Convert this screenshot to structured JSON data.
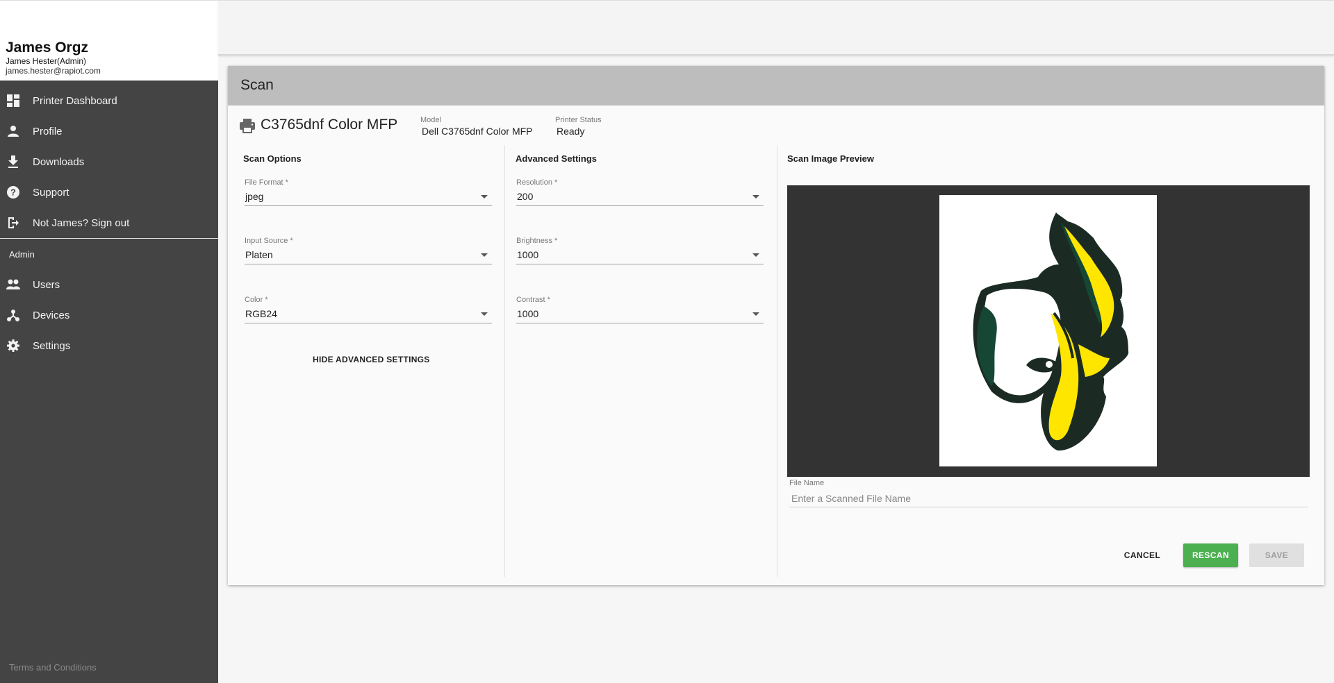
{
  "user": {
    "org": "James Orgz",
    "name": "James Hester",
    "role": "(Admin)",
    "email": "james.hester@rapiot.com"
  },
  "nav": {
    "items": [
      {
        "label": "Printer Dashboard",
        "icon": "dashboard-icon"
      },
      {
        "label": "Profile",
        "icon": "person-icon"
      },
      {
        "label": "Downloads",
        "icon": "download-icon"
      },
      {
        "label": "Support",
        "icon": "help-icon"
      },
      {
        "label": "Not James? Sign out",
        "icon": "logout-icon"
      }
    ],
    "admin_section": "Admin",
    "admin_items": [
      {
        "label": "Users",
        "icon": "people-icon"
      },
      {
        "label": "Devices",
        "icon": "devices-icon"
      },
      {
        "label": "Settings",
        "icon": "gear-icon"
      }
    ],
    "terms": "Terms and Conditions"
  },
  "scan": {
    "title": "Scan",
    "printer_name": "C3765dnf Color MFP",
    "model_label": "Model",
    "model_value": "Dell C3765dnf Color MFP",
    "status_label": "Printer Status",
    "status_value": "Ready"
  },
  "scan_options": {
    "title": "Scan Options",
    "fields": [
      {
        "label": "File Format *",
        "value": "jpeg"
      },
      {
        "label": "Input Source *",
        "value": "Platen"
      },
      {
        "label": "Color *",
        "value": "RGB24"
      }
    ],
    "hide_button": "HIDE ADVANCED SETTINGS"
  },
  "advanced": {
    "title": "Advanced Settings",
    "fields": [
      {
        "label": "Resolution *",
        "value": "200"
      },
      {
        "label": "Brightness *",
        "value": "1000"
      },
      {
        "label": "Contrast *",
        "value": "1000"
      }
    ]
  },
  "preview": {
    "title": "Scan Image Preview",
    "file_name_label": "File Name",
    "file_name_placeholder": "Enter a Scanned File Name"
  },
  "actions": {
    "cancel": "CANCEL",
    "rescan": "RESCAN",
    "save": "SAVE"
  },
  "colors": {
    "sidebar": "#444444",
    "header": "#bdbdbd",
    "rescan": "#4caf50",
    "preview_bg": "#333333",
    "logo_yellow": "#ffe600",
    "logo_green": "#154734"
  }
}
